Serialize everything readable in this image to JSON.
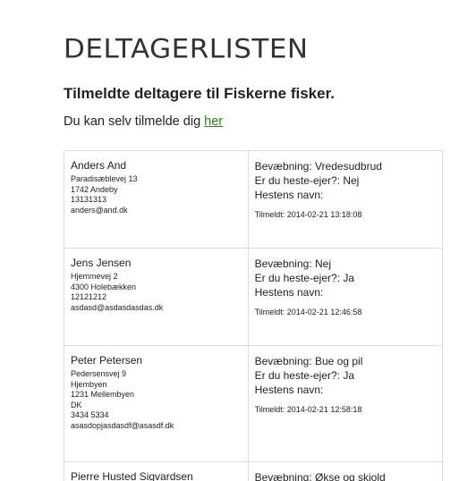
{
  "page": {
    "title": "DELTAGERLISTEN",
    "subtitle": "Tilmeldte deltagere til Fiskerne fisker.",
    "signup_prefix": "Du kan selv tilmelde dig ",
    "signup_link": "her"
  },
  "participants": [
    {
      "name": "Anders And",
      "address_lines": [
        "Paradisæblevej 13",
        "1742 Andeby",
        "13131313",
        "anders@and.dk"
      ],
      "weapon": "Bevæbning: Vredesudbrud",
      "horse_owner": "Er du heste-ejer?: Nej",
      "horse_name": "Hestens navn:",
      "registered": "Tilmeldt: 2014-02-21 13:18:08"
    },
    {
      "name": "Jens Jensen",
      "address_lines": [
        "Hjemmevej 2",
        "4300 Holebækken",
        "12121212",
        "asdasd@asdasdasdas.dk"
      ],
      "weapon": "Bevæbning: Nej",
      "horse_owner": "Er du heste-ejer?: Ja",
      "horse_name": "Hestens navn:",
      "registered": "Tilmeldt: 2014-02-21 12:46:58"
    },
    {
      "name": "Peter Petersen",
      "address_lines": [
        "Pedersensvej 9",
        "Hjembyen",
        "1231 Mellembyen",
        "DK",
        "3434 5334",
        "asasdopjasdasdf@asasdf.dk"
      ],
      "weapon": "Bevæbning: Bue og pil",
      "horse_owner": "Er du heste-ejer?: Ja",
      "horse_name": "Hestens navn:",
      "registered": "Tilmeldt: 2014-02-21 12:58:18"
    },
    {
      "name": "Pierre Husted Sigvardsen",
      "weapon": "Bevæbning: Økse og skjold"
    }
  ]
}
